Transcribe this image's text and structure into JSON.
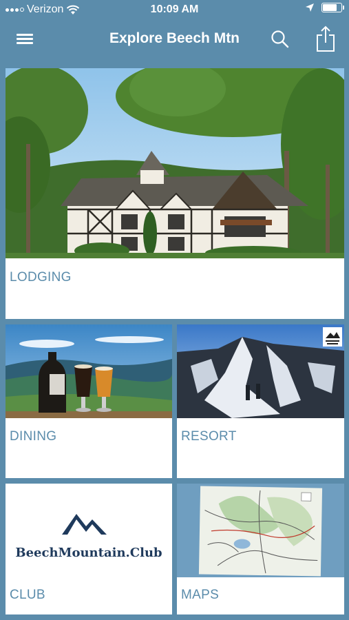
{
  "status": {
    "carrier": "Verizon",
    "time": "10:09 AM",
    "battery_level": 0.8,
    "icons": [
      "signal-dots-icon",
      "wifi-icon",
      "location-arrow-icon",
      "battery-icon"
    ]
  },
  "nav": {
    "title": "Explore Beech Mtn",
    "icons": [
      "hamburger-menu-icon",
      "search-icon",
      "share-icon"
    ]
  },
  "tiles": [
    {
      "label": "LODGING"
    },
    {
      "label": "DINING"
    },
    {
      "label": "RESORT"
    },
    {
      "label": "CLUB"
    },
    {
      "label": "MAPS"
    }
  ],
  "club_logo": {
    "text": "BeechMountain.Club"
  },
  "colors": {
    "accent": "#5b8cab",
    "logo_navy": "#1f3a5c"
  }
}
